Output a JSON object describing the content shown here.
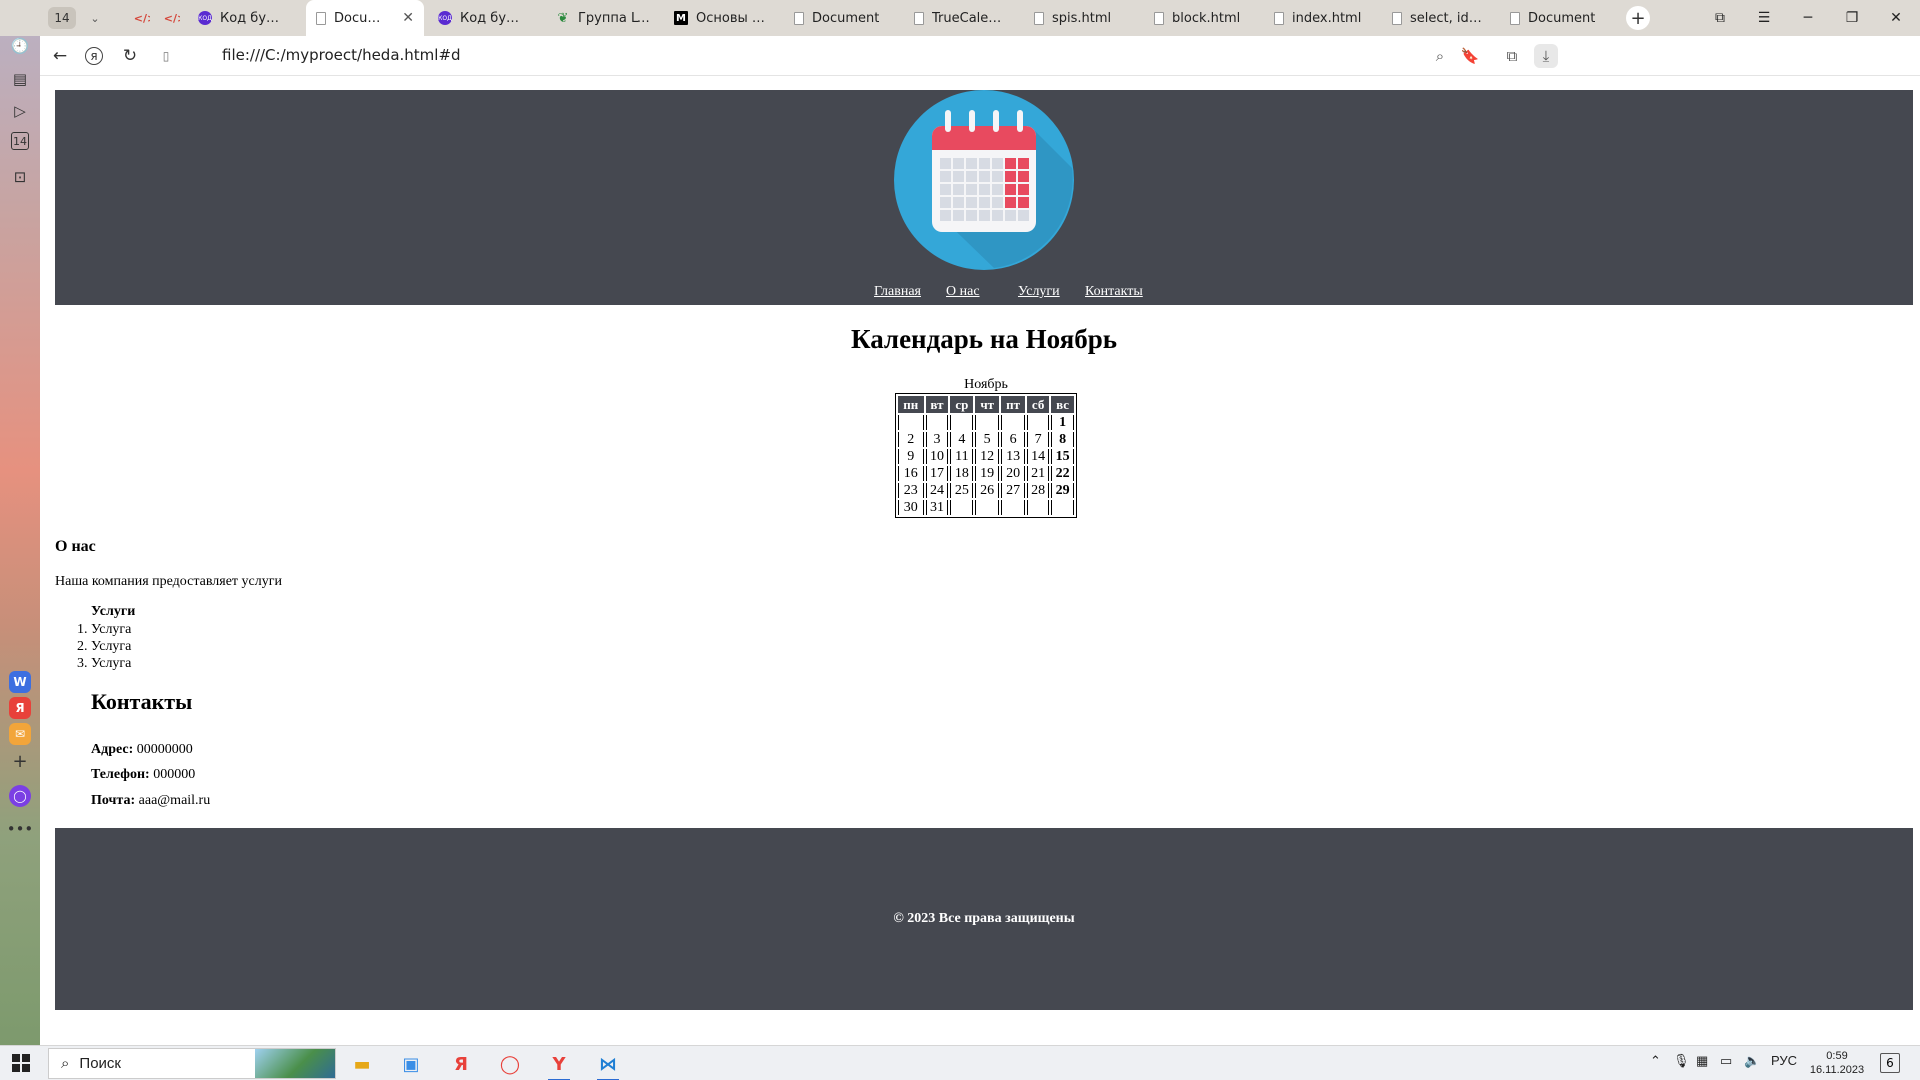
{
  "browser": {
    "tab_counter": "14",
    "tabs": [
      {
        "label": "Код будуще"
      },
      {
        "label": "Document"
      },
      {
        "label": "Код будуще"
      },
      {
        "label": "Группа LVIT"
      },
      {
        "label": "Основы CSS"
      },
      {
        "label": "Document"
      },
      {
        "label": "TrueCalendar"
      },
      {
        "label": "spis.html"
      },
      {
        "label": "block.html"
      },
      {
        "label": "index.html"
      },
      {
        "label": "select, id,clas"
      },
      {
        "label": "Document"
      }
    ],
    "url": "file:///C:/myproect/heda.html#d",
    "rail_counter": "14"
  },
  "page": {
    "nav": {
      "home": "Главная",
      "about": "О нас",
      "services": "Услуги",
      "contacts": "Контакты"
    },
    "title": "Календарь на Ноябрь",
    "calendar": {
      "caption": "Ноябрь",
      "weekdays": [
        "пн",
        "вт",
        "ср",
        "чт",
        "пт",
        "сб",
        "вс"
      ],
      "rows": [
        [
          "",
          "",
          "",
          "",
          "",
          "",
          "1"
        ],
        [
          "2",
          "3",
          "4",
          "5",
          "6",
          "7",
          "8"
        ],
        [
          "9",
          "10",
          "11",
          "12",
          "13",
          "14",
          "15"
        ],
        [
          "16",
          "17",
          "18",
          "19",
          "20",
          "21",
          "22"
        ],
        [
          "23",
          "24",
          "25",
          "26",
          "27",
          "28",
          "29"
        ],
        [
          "30",
          "31",
          "",
          "",
          "",
          "",
          ""
        ]
      ]
    },
    "about": {
      "title": "О нас",
      "text": "Наша компания предоставляет услуги"
    },
    "services": {
      "title": "Услуги",
      "items": [
        "Услуга",
        "Услуга",
        "Услуга"
      ]
    },
    "contacts": {
      "title": "Контакты",
      "address_label": "Адрес:",
      "address_value": "00000000",
      "phone_label": "Телефон:",
      "phone_value": "000000",
      "email_label": "Почта:",
      "email_value": "aaa@mail.ru"
    },
    "footer": "© 2023 Все права защищены"
  },
  "taskbar": {
    "search_placeholder": "Поиск",
    "lang": "РУС",
    "time": "0:59",
    "date": "16.11.2023",
    "notifications": "6"
  },
  "colors": {
    "header_bg": "#454850",
    "logo_circle": "#34a7d8",
    "calendar_red": "#e84a5f"
  }
}
